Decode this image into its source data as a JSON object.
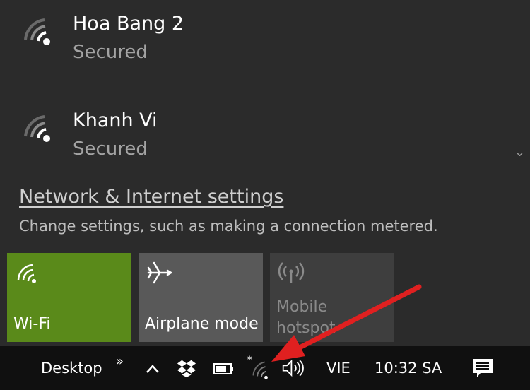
{
  "networks": [
    {
      "name": "Hoa Bang 2",
      "status": "Secured",
      "icon": "wifi-signal-icon"
    },
    {
      "name": "Khanh Vi",
      "status": "Secured",
      "icon": "wifi-signal-icon"
    }
  ],
  "settings": {
    "link_label": "Network & Internet settings",
    "description": "Change settings, such as making a connection metered."
  },
  "quick_actions": [
    {
      "label": "Wi-Fi",
      "state": "on",
      "icon": "wifi-icon",
      "color": "#5a8a1a"
    },
    {
      "label": "Airplane mode",
      "state": "off",
      "icon": "airplane-icon",
      "color": "#595959"
    },
    {
      "label": "Mobile hotspot",
      "state": "disabled",
      "icon": "hotspot-icon",
      "color": "#3e3e3e"
    }
  ],
  "taskbar": {
    "desktop_label": "Desktop",
    "overflow_glyph": "»",
    "language": "VIE",
    "time": "10:32 SA",
    "icons": [
      "show-hidden-icons",
      "dropbox-icon",
      "battery-icon",
      "network-wifi-icon",
      "volume-icon",
      "action-center-icon"
    ]
  },
  "annotation": {
    "type": "red-arrow",
    "color": "#e02020",
    "points_to": "network-wifi-icon"
  }
}
